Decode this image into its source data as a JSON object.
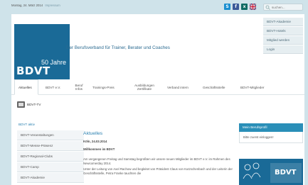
{
  "topbar": {
    "date": "Montag, 24. März 2014",
    "impressum": "Impressum",
    "search_placeholder": "suchen...",
    "social_icons": [
      "skype-icon",
      "facebook-icon",
      "xing-icon",
      "uk-flag-icon"
    ]
  },
  "logo": {
    "years": "50 Jahre",
    "name": "BDVT"
  },
  "tagline": "Der Berufsverband für Trainer, Berater und Coaches",
  "quick_links": [
    "BDVT-Akademie",
    "BDVT-Hotels",
    "Mitglied werden",
    "Login"
  ],
  "nav": {
    "tabs": [
      {
        "label": "Aktuelles",
        "active": true
      },
      {
        "label": "BDVT e.V."
      },
      {
        "label": "Beruf Infos"
      },
      {
        "label": "Trainings-Preis"
      },
      {
        "label": "Ausbildungen Zertifikate"
      },
      {
        "label": "Verband intern"
      },
      {
        "label": "Geschäftsstelle"
      },
      {
        "label": "BDVT-Mitglieder"
      }
    ]
  },
  "subnav": {
    "label": "BDVT-TV"
  },
  "sidebar": {
    "title": "BDVT aktiv",
    "items": [
      "BDVT-Veranstaltungen",
      "BDVT-Messe-Präsenz",
      "BDVT-Regional-Clubs",
      "BDVT-Camp",
      "BDVT-Akademie"
    ]
  },
  "content": {
    "heading": "Aktuelles",
    "date": "Köln, 24.03.2014",
    "welcome": "Willkommen im BDVT",
    "para1": "Am vergangenen Freitag und Samstag begrüßten wir unsere neuen Mitglieder im BDVT e.V. im Rahmen des Newcomerday 2014.",
    "para2": "Unter der Leitung von Axel Rachow und begleitet von Präsident Claus von Kutzschenbach und der Leiterin der Geschäftsstelle, Petra Franke tauchten die"
  },
  "rightbox": {
    "title": "Mein Berufsprofil",
    "body": "Bitte zuerst einloggen!"
  },
  "right_image": {
    "label": "BDVT"
  },
  "colors": {
    "brand": "#1a6a97",
    "accent": "#2a8fb8",
    "background": "#cfe3ea"
  }
}
